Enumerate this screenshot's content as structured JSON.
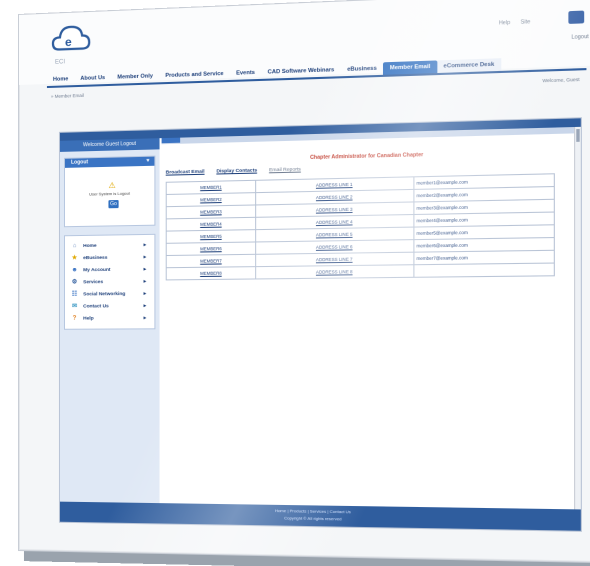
{
  "header": {
    "logo_text": "ECI",
    "top_links": [
      "Help",
      "Site"
    ],
    "logout": "Logout"
  },
  "nav": {
    "items": [
      "Home",
      "About Us",
      "Member Only",
      "Products and Service",
      "Events",
      "CAD Software Webinars",
      "eBusiness",
      "Member Email",
      "eCommerce Desk"
    ],
    "active_index": 7
  },
  "breadcrumb": "» Member Email",
  "welcome": "Welcome, Guest",
  "sidebar": {
    "title": "Welcome Guest Logout",
    "login_panel": {
      "head": "Logout",
      "warning": "User System is Logout",
      "go_button": "Go"
    },
    "menu": [
      {
        "label": "Home",
        "icon": "home-icon"
      },
      {
        "label": "eBusiness",
        "icon": "star-icon"
      },
      {
        "label": "My Account",
        "icon": "user-icon"
      },
      {
        "label": "Services",
        "icon": "gear-icon"
      },
      {
        "label": "Social Networking",
        "icon": "people-icon"
      },
      {
        "label": "Contact Us",
        "icon": "contact-icon"
      },
      {
        "label": "Help",
        "icon": "help-icon"
      }
    ]
  },
  "main": {
    "chapter_title": "Chapter Administrator for Canadian Chapter",
    "tabs": [
      "Broadcast Email",
      "Display Contacts",
      "Email Reports"
    ],
    "members": [
      {
        "name": "MEMBER1",
        "address": "ADDRESS LINE 1",
        "email": "member1@example.com"
      },
      {
        "name": "MEMBER2",
        "address": "ADDRESS LINE 2",
        "email": "member2@example.com"
      },
      {
        "name": "MEMBER3",
        "address": "ADDRESS LINE 3",
        "email": "member3@example.com"
      },
      {
        "name": "MEMBER4",
        "address": "ADDRESS LINE 4",
        "email": "member4@example.com"
      },
      {
        "name": "MEMBER5",
        "address": "ADDRESS LINE 5",
        "email": "member5@example.com"
      },
      {
        "name": "MEMBER6",
        "address": "ADDRESS LINE 6",
        "email": "member6@example.com"
      },
      {
        "name": "MEMBER7",
        "address": "ADDRESS LINE 7",
        "email": "member7@example.com"
      },
      {
        "name": "MEMBER8",
        "address": "ADDRESS LINE 8",
        "email": ""
      }
    ]
  },
  "footer": {
    "links": "Home | Products | Services | Contact Us",
    "copyright": "Copyright © All rights reserved"
  },
  "colors": {
    "brand_blue": "#2f5d9e",
    "active_tab": "#2f6fc0",
    "alert_red": "#c0392b"
  }
}
